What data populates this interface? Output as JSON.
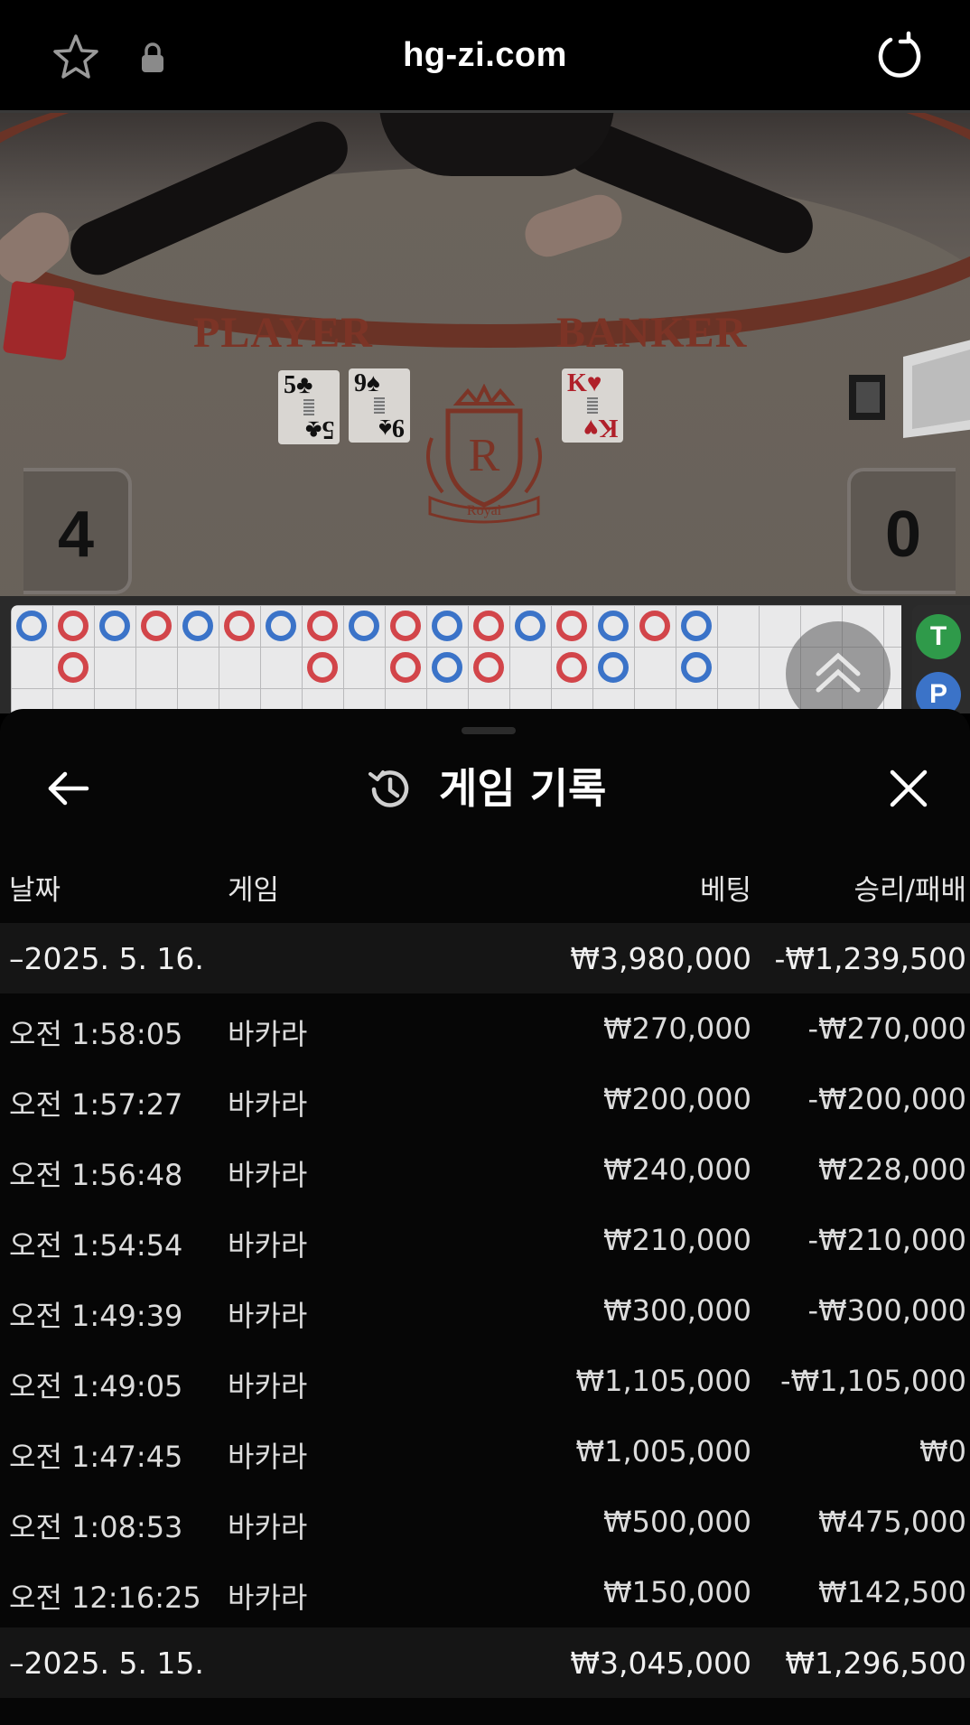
{
  "browser": {
    "url": "hg-zi.com"
  },
  "game_view": {
    "player_label": "PLAYER",
    "banker_label": "BANKER",
    "player_score": "4",
    "banker_score": "0",
    "player_cards": [
      {
        "rank": "5",
        "suit": "♣"
      },
      {
        "rank": "9",
        "suit": "♠"
      }
    ],
    "banker_cards": [
      {
        "rank": "K",
        "suit": "♥"
      }
    ],
    "emblem_letter": "R",
    "emblem_text": "Royal",
    "side_buttons": [
      "T",
      "P"
    ],
    "colors": {
      "player_blue": "#3b73c8",
      "banker_red": "#d2454a",
      "tie_green": "#2f9a4a",
      "label_brown": "#7c3426"
    }
  },
  "roadmap": {
    "row1": [
      "P",
      "B",
      "P",
      "B",
      "P",
      "B",
      "P",
      "B",
      "P",
      "B",
      "P",
      "B",
      "P",
      "B",
      "P",
      "B",
      "P"
    ],
    "row2": [
      null,
      "B",
      null,
      null,
      null,
      null,
      null,
      "B",
      null,
      "B",
      "P",
      "B",
      null,
      "B",
      "P",
      null,
      "P"
    ]
  },
  "history": {
    "title": "게임 기록",
    "columns": {
      "date": "날짜",
      "game": "게임",
      "bet": "베팅",
      "result": "승리/패배"
    },
    "groups": [
      {
        "date": "–2025. 5. 16.",
        "bet": "₩3,980,000",
        "result": "-₩1,239,500",
        "rows": [
          {
            "time": "오전 1:58:05",
            "game": "바카라",
            "bet": "₩270,000",
            "result": "-₩270,000"
          },
          {
            "time": "오전 1:57:27",
            "game": "바카라",
            "bet": "₩200,000",
            "result": "-₩200,000"
          },
          {
            "time": "오전 1:56:48",
            "game": "바카라",
            "bet": "₩240,000",
            "result": "₩228,000"
          },
          {
            "time": "오전 1:54:54",
            "game": "바카라",
            "bet": "₩210,000",
            "result": "-₩210,000"
          },
          {
            "time": "오전 1:49:39",
            "game": "바카라",
            "bet": "₩300,000",
            "result": "-₩300,000"
          },
          {
            "time": "오전 1:49:05",
            "game": "바카라",
            "bet": "₩1,105,000",
            "result": "-₩1,105,000"
          },
          {
            "time": "오전 1:47:45",
            "game": "바카라",
            "bet": "₩1,005,000",
            "result": "₩0"
          },
          {
            "time": "오전 1:08:53",
            "game": "바카라",
            "bet": "₩500,000",
            "result": "₩475,000"
          },
          {
            "time": "오전 12:16:25",
            "game": "바카라",
            "bet": "₩150,000",
            "result": "₩142,500"
          }
        ]
      },
      {
        "date": "–2025. 5. 15.",
        "bet": "₩3,045,000",
        "result": "₩1,296,500",
        "rows": []
      }
    ]
  }
}
